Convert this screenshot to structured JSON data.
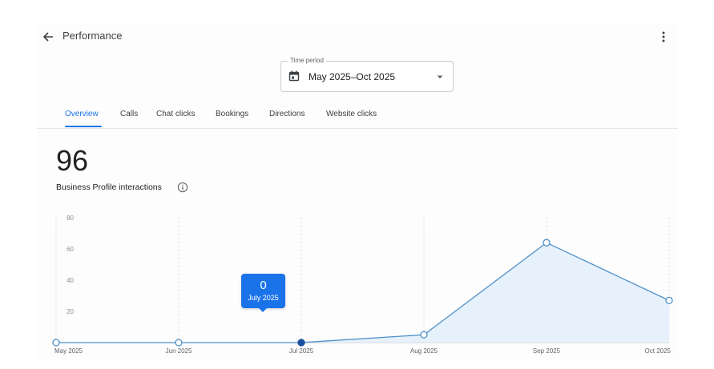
{
  "header": {
    "title": "Performance"
  },
  "time_period": {
    "label": "Time period",
    "value": "May 2025–Oct 2025"
  },
  "tabs": [
    {
      "label": "Overview",
      "active": true
    },
    {
      "label": "Calls"
    },
    {
      "label": "Chat clicks"
    },
    {
      "label": "Bookings"
    },
    {
      "label": "Directions"
    },
    {
      "label": "Website clicks"
    }
  ],
  "metric": {
    "value": "96",
    "label": "Business Profile interactions"
  },
  "tooltip": {
    "value": "0",
    "date": "July 2025"
  },
  "colors": {
    "accent": "#1a73e8",
    "line": "#4f90c7",
    "area": "#e3eefb"
  },
  "icons": [
    "arrow-back-icon",
    "more-vert-icon",
    "calendar-icon",
    "dropdown-caret-icon",
    "info-icon"
  ],
  "chart_data": {
    "type": "area",
    "x": [
      "May 2025",
      "Jun 2025",
      "Jul 2025",
      "Aug 2025",
      "Sep 2025",
      "Oct 2025"
    ],
    "series": [
      {
        "values": [
          0,
          0,
          0,
          5,
          64,
          27
        ]
      }
    ],
    "y_ticks": [
      "20",
      "40",
      "60",
      "80"
    ],
    "ylim": [
      0,
      80
    ],
    "selected_point": "Jul 2025",
    "grid": "vertical dashed",
    "legend": "none"
  }
}
